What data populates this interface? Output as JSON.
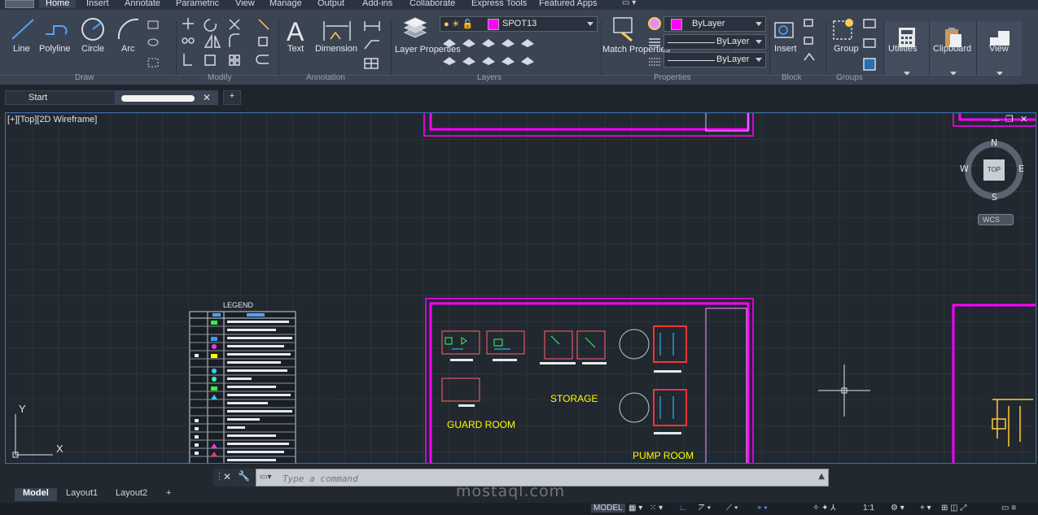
{
  "ribbon_tabs": [
    "Home",
    "Insert",
    "Annotate",
    "Parametric",
    "View",
    "Manage",
    "Output",
    "Add-ins",
    "Collaborate",
    "Express Tools",
    "Featured Apps"
  ],
  "active_tab": "Home",
  "draw_panel": {
    "title": "Draw",
    "tools": [
      "Line",
      "Polyline",
      "Circle",
      "Arc"
    ]
  },
  "modify_panel": {
    "title": "Modify"
  },
  "annotation_panel": {
    "title": "Annotation",
    "tools": [
      "Text",
      "Dimension"
    ]
  },
  "layers_panel": {
    "title": "Layers",
    "layer_properties_label": "Layer Properties",
    "current_layer": "SPOT13"
  },
  "properties_panel": {
    "title": "Properties",
    "match_properties_label": "Match Properties",
    "color": "ByLayer",
    "linetype": "ByLayer",
    "lineweight": "ByLayer"
  },
  "block_panel": {
    "title": "Block",
    "insert_label": "Insert"
  },
  "groups_panel": {
    "title": "Groups",
    "group_label": "Group"
  },
  "big_buttons": [
    "Utilities",
    "Clipboard",
    "View"
  ],
  "file_tabs": {
    "start": "Start",
    "drawing_name": "",
    "add": "+"
  },
  "viewport": {
    "label": "[+][Top][2D Wireframe]",
    "viewcube": {
      "top": "TOP",
      "north": "N",
      "south": "S",
      "east": "E",
      "west": "W",
      "wcs": "WCS"
    },
    "ucs": {
      "x": "X",
      "y": "Y"
    },
    "drawing_labels": {
      "legend": "LEGEND",
      "guard_room": "GUARD ROOM",
      "storage": "STORAGE",
      "pump_room": "PUMP ROOM"
    }
  },
  "command_line": {
    "placeholder": "Type a command"
  },
  "layout_tabs": [
    "Model",
    "Layout1",
    "Layout2"
  ],
  "layout_add": "+",
  "status_bar": {
    "model": "MODEL",
    "scale": "1:1"
  },
  "watermark": "mostaql.com",
  "colors": {
    "magenta": "#ff00ff",
    "accent": "#3a6fb0"
  }
}
